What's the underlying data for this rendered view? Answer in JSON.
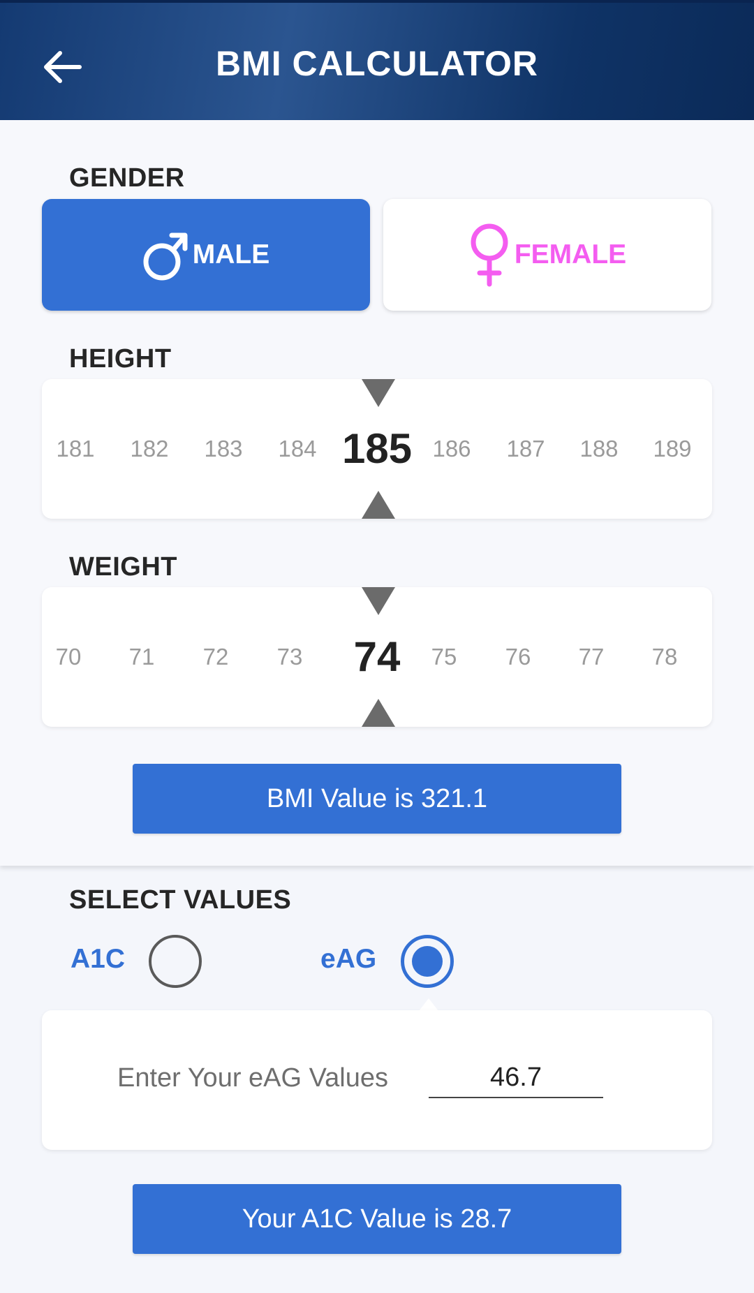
{
  "header": {
    "title": "BMI CALCULATOR",
    "back_icon": "arrow-left-icon"
  },
  "gender": {
    "label": "GENDER",
    "selected": "male",
    "male": {
      "label": "MALE",
      "icon": "male-icon"
    },
    "female": {
      "label": "FEMALE",
      "icon": "female-icon"
    },
    "colors": {
      "selected_bg": "#3370d4",
      "female_accent": "#f45df0"
    }
  },
  "height": {
    "label": "HEIGHT",
    "values": [
      "181",
      "182",
      "183",
      "184",
      "185",
      "186",
      "187",
      "188",
      "189"
    ],
    "selected": "185"
  },
  "weight": {
    "label": "WEIGHT",
    "values": [
      "70",
      "71",
      "72",
      "73",
      "74",
      "75",
      "76",
      "77",
      "78"
    ],
    "selected": "74"
  },
  "bmi_result": "BMI Value is 321.1",
  "select_values": {
    "label": "SELECT VALUES",
    "options": [
      {
        "label": "A1C",
        "checked": false
      },
      {
        "label": "eAG",
        "checked": true
      }
    ]
  },
  "eag_input": {
    "label": "Enter Your eAG Values",
    "value": "46.7"
  },
  "a1c_result": "Your A1C Value is 28.7",
  "accent_color": "#3370d4"
}
